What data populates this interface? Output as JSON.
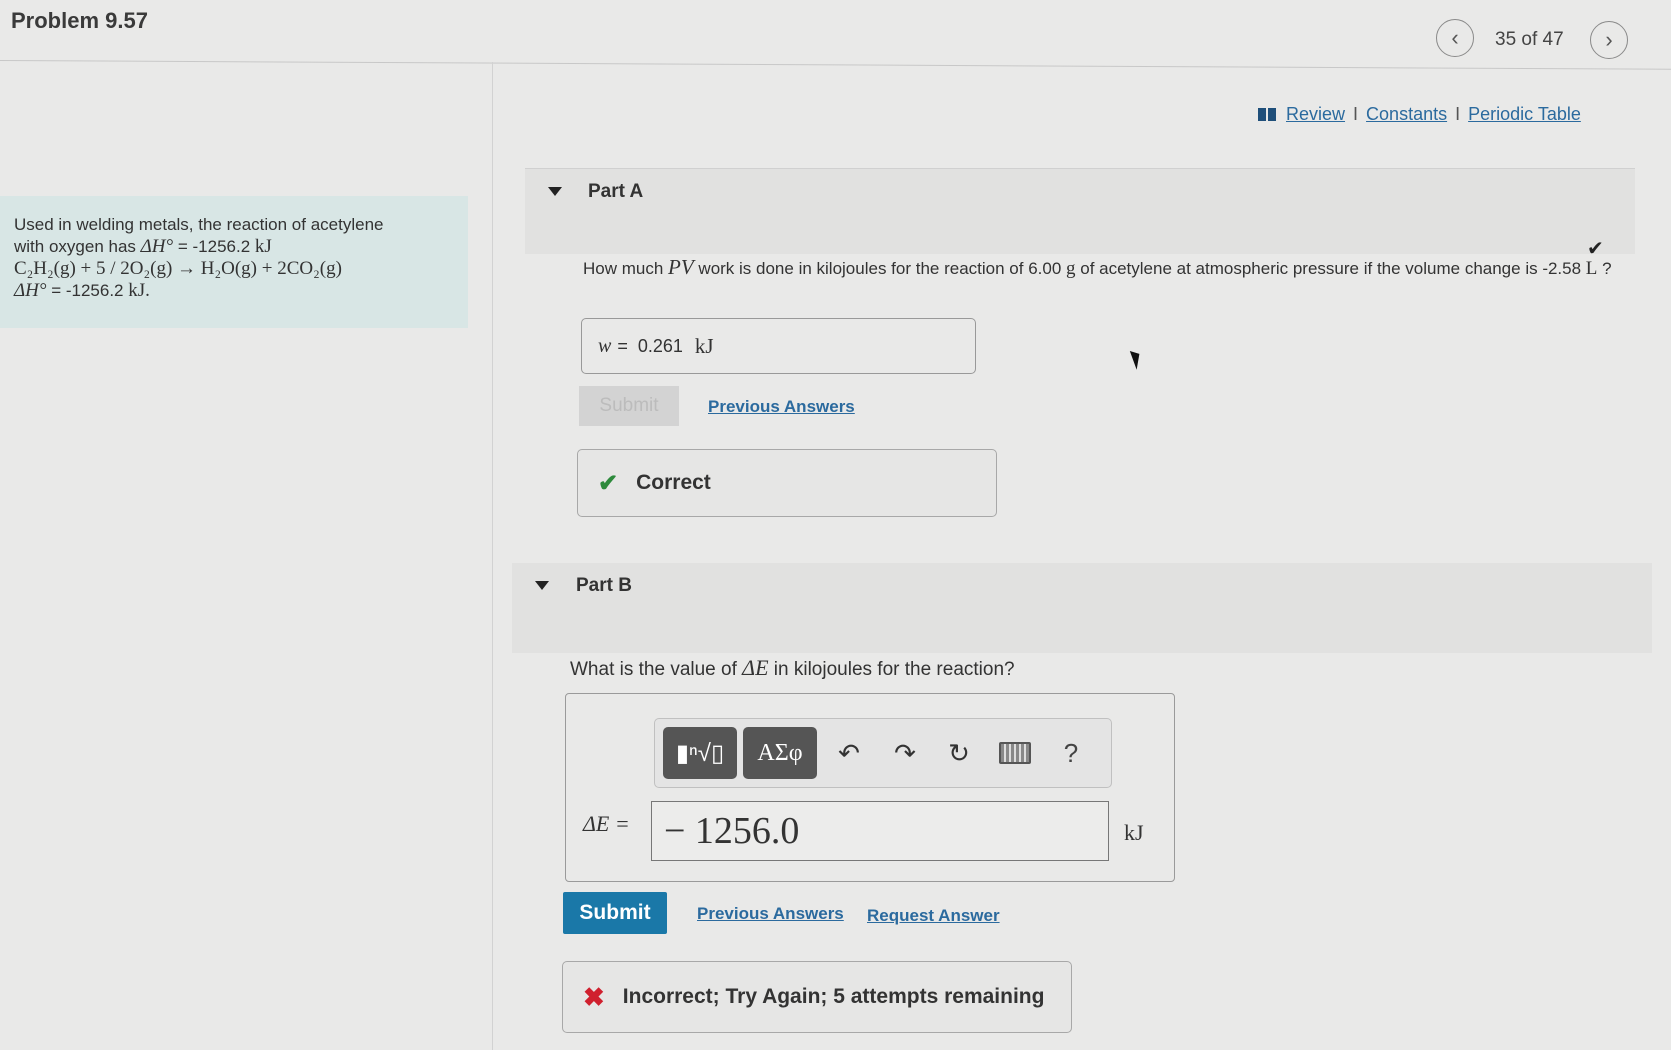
{
  "header": {
    "title": "Problem 9.57",
    "counter": "35 of 47",
    "prev_icon": "chevron-left-icon",
    "next_icon": "chevron-right-icon"
  },
  "resources": {
    "icon": "book-icon",
    "links": [
      "Review",
      "Constants",
      "Periodic Table"
    ],
    "separator": "I"
  },
  "intro": {
    "line1": "Used in welding metals, the reaction of acetylene",
    "line2_prefix": "with oxygen has ",
    "dh_symbol": "ΔH°",
    "line2_value": " = -1256.2 ",
    "line2_unit": "kJ",
    "equation": "C₂H₂(g) + 5 / 2O₂(g) → H₂O(g) + 2CO₂(g)",
    "line4_value": " = -1256.2 ",
    "line4_unit": "kJ."
  },
  "partA": {
    "label": "Part A",
    "status_icon": "check-icon",
    "question_prefix": "How much ",
    "question_var": "PV",
    "question_mid": " work is done in kilojoules for the reaction of 6.00 ",
    "question_g": "g",
    "question_rest": " of acetylene at atmospheric pressure if the volume change is -2.58 ",
    "question_unit": "L",
    "question_end": " ?",
    "answer_var": "w",
    "answer_eq": "=",
    "answer_value": "0.261",
    "answer_unit": "kJ",
    "submit_label": "Submit",
    "previous_answers": "Previous Answers",
    "feedback_icon": "✔",
    "feedback": "Correct"
  },
  "partB": {
    "label": "Part B",
    "question_prefix": "What is the value of ",
    "question_var": "ΔE",
    "question_rest": " in kilojoules for the reaction?",
    "toolbar": {
      "template_label": "▮ⁿ√▯",
      "greek_label": "ΑΣφ",
      "undo": "↶",
      "redo": "↷",
      "reset": "↻",
      "help": "?"
    },
    "input_label": "ΔE =",
    "input_value": "− 1256.0",
    "unit": "kJ",
    "submit_label": "Submit",
    "previous_answers": "Previous Answers",
    "request_answer": "Request Answer",
    "feedback_icon": "✖",
    "feedback": "Incorrect; Try Again; 5 attempts remaining",
    "colors": {
      "submit_bg": "#1a78a8",
      "error": "#d0202e",
      "success": "#2d8a3b"
    }
  }
}
